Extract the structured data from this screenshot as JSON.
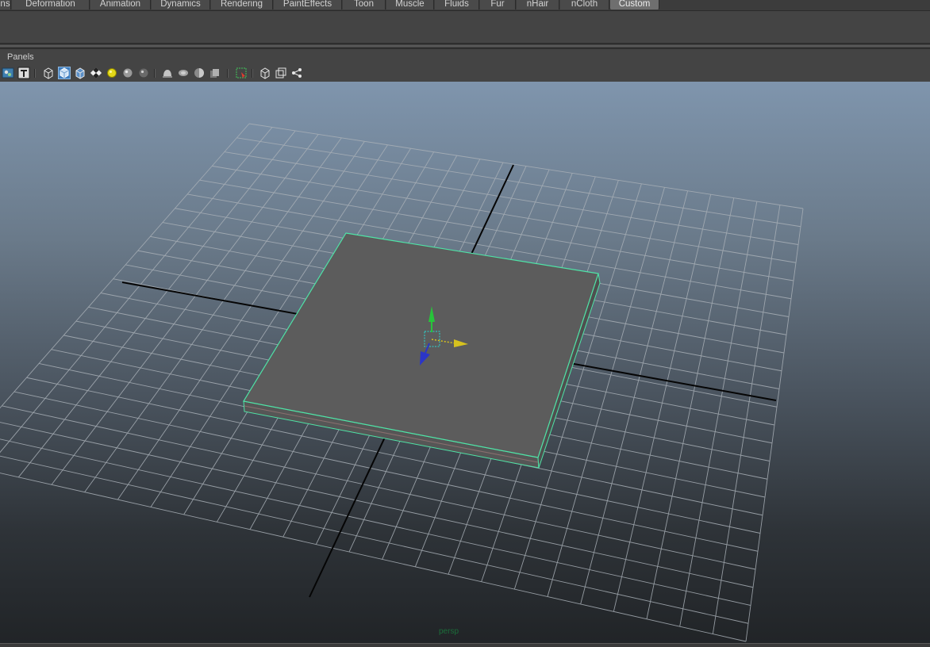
{
  "shelf": {
    "tabs": [
      {
        "label": "ns",
        "active": false
      },
      {
        "label": "Deformation",
        "active": false
      },
      {
        "label": "Animation",
        "active": false
      },
      {
        "label": "Dynamics",
        "active": false
      },
      {
        "label": "Rendering",
        "active": false
      },
      {
        "label": "PaintEffects",
        "active": false
      },
      {
        "label": "Toon",
        "active": false
      },
      {
        "label": "Muscle",
        "active": false
      },
      {
        "label": "Fluids",
        "active": false
      },
      {
        "label": "Fur",
        "active": false
      },
      {
        "label": "nHair",
        "active": false
      },
      {
        "label": "nCloth",
        "active": false
      },
      {
        "label": "Custom",
        "active": true
      }
    ]
  },
  "panel": {
    "menu_label": "Panels",
    "toolbar_icons": [
      "camera-attributes-icon",
      "text-icon",
      "wireframe-cube-icon",
      "smooth-shade-icon",
      "shaded-wireframe-icon",
      "texture-checker-icon",
      "default-light-icon",
      "all-lights-icon",
      "shadow-icon",
      "xray-icon",
      "xray-joints-icon",
      "backface-icon",
      "ambient-occlusion-icon",
      "isolate-select-icon",
      "bounding-box-icon",
      "hud-icon",
      "graph-icon"
    ]
  },
  "viewport": {
    "camera_label": "persp",
    "colors": {
      "selection_highlight": "#4fe3a6",
      "axis_y": "#27c43a",
      "axis_x": "#d6c21f",
      "axis_z": "#2b35c8",
      "grid": "#a7afb7",
      "grid_axis": "#000000",
      "object_face": "#5a5a5a"
    }
  }
}
